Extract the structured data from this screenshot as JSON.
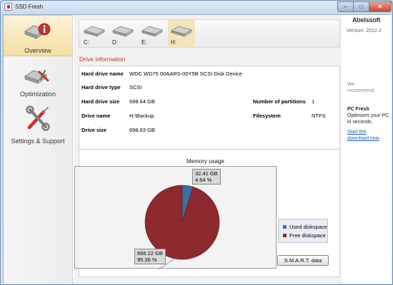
{
  "window": {
    "title": "SSD Fresh"
  },
  "sidebar": {
    "items": [
      {
        "label": "Overview",
        "icon": "ssd-info-icon"
      },
      {
        "label": "Optimization",
        "icon": "ssd-tools-icon"
      },
      {
        "label": "Settings & Support",
        "icon": "wrench-screwdriver-icon"
      }
    ]
  },
  "drives": [
    {
      "label": "C:"
    },
    {
      "label": "D:"
    },
    {
      "label": "E:"
    },
    {
      "label": "H:"
    }
  ],
  "drive_info": {
    "section_title": "Drive information",
    "hard_drive_name_label": "Hard drive name",
    "hard_drive_name": "WDC WD75 00AARS-00Y5B SCSI Disk Device",
    "hard_drive_type_label": "Hard drive type",
    "hard_drive_type": "SCSI",
    "hard_drive_size_label": "Hard drive size",
    "hard_drive_size": "698.64 GB",
    "partitions_label": "Number of partitions",
    "partitions": "1",
    "drive_name_label": "Drive name",
    "drive_name": "H:\\Backup",
    "filesystem_label": "Filesystem",
    "filesystem": "NTFS",
    "drive_size_label": "Drive size",
    "drive_size": "698.63 GB"
  },
  "chart_data": {
    "type": "pie",
    "title": "Memory usage",
    "series": [
      {
        "name": "Used diskspace",
        "value": 4.64,
        "size_label": "32.41 GB",
        "pct_label": "4.64 %",
        "color": "#3f6fa3"
      },
      {
        "name": "Free diskspace",
        "value": 95.36,
        "size_label": "666.22 GB",
        "pct_label": "95.36 %",
        "color": "#8e2a2f"
      }
    ],
    "legend_position": "right"
  },
  "buttons": {
    "smart": "S.M.A.R.T. data"
  },
  "right_panel": {
    "brand": "Abelssoft",
    "version": "Version: 2012.2",
    "we": "We",
    "recommend": "recommend:",
    "product": "PC Fresh",
    "product_desc_1": "Optimizes your PC",
    "product_desc_2": "in seconds.",
    "link_1": "Start the",
    "link_2": "download now"
  }
}
